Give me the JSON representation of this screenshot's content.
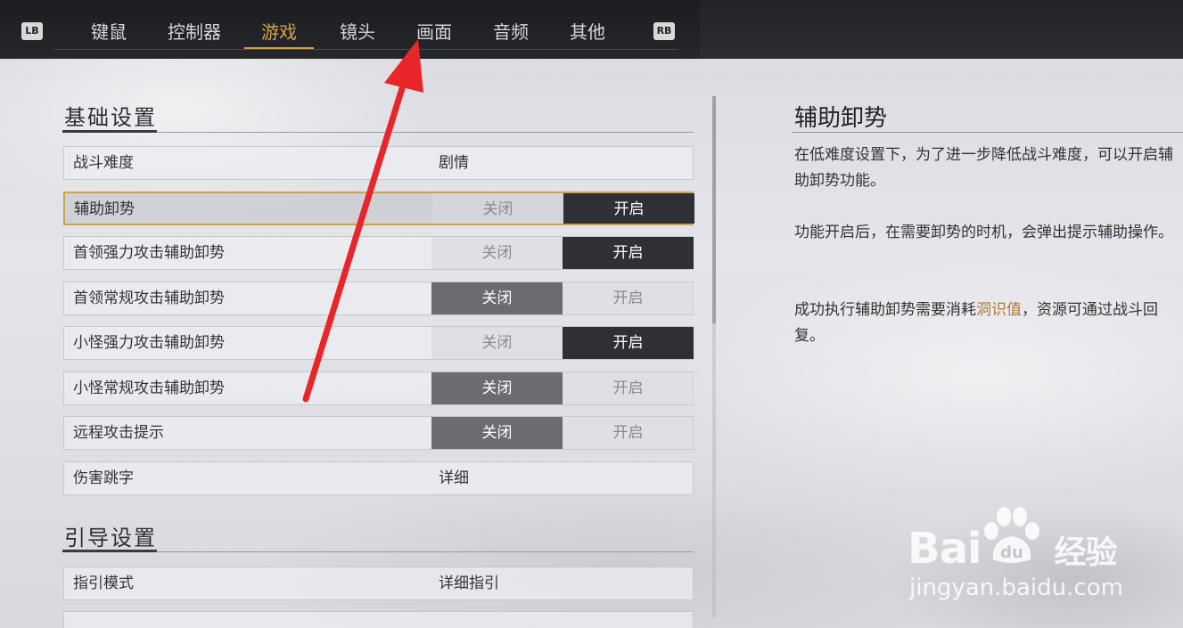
{
  "nav": {
    "left_shoulder": "LB",
    "right_shoulder": "RB",
    "tabs": [
      {
        "label": "键鼠",
        "active": false
      },
      {
        "label": "控制器",
        "active": false
      },
      {
        "label": "游戏",
        "active": true
      },
      {
        "label": "镜头",
        "active": false
      },
      {
        "label": "画面",
        "active": false
      },
      {
        "label": "音频",
        "active": false
      },
      {
        "label": "其他",
        "active": false
      }
    ],
    "active_color": "#d7a24a"
  },
  "sections": [
    {
      "title": "基础设置",
      "rows": [
        {
          "label": "战斗难度",
          "type": "value",
          "value": "剧情"
        },
        {
          "label": "辅助卸势",
          "type": "toggle",
          "off_label": "关闭",
          "on_label": "开启",
          "state": "on",
          "focused": true
        },
        {
          "label": "首领强力攻击辅助卸势",
          "type": "toggle",
          "off_label": "关闭",
          "on_label": "开启",
          "state": "on"
        },
        {
          "label": "首领常规攻击辅助卸势",
          "type": "toggle",
          "off_label": "关闭",
          "on_label": "开启",
          "state": "off"
        },
        {
          "label": "小怪强力攻击辅助卸势",
          "type": "toggle",
          "off_label": "关闭",
          "on_label": "开启",
          "state": "on"
        },
        {
          "label": "小怪常规攻击辅助卸势",
          "type": "toggle",
          "off_label": "关闭",
          "on_label": "开启",
          "state": "off"
        },
        {
          "label": "远程攻击提示",
          "type": "toggle",
          "off_label": "关闭",
          "on_label": "开启",
          "state": "off"
        },
        {
          "label": "伤害跳字",
          "type": "value",
          "value": "详细"
        }
      ]
    },
    {
      "title": "引导设置",
      "rows": [
        {
          "label": "指引模式",
          "type": "value",
          "value": "详细指引"
        }
      ]
    }
  ],
  "detail": {
    "title": "辅助卸势",
    "para1": "在低难度设置下，为了进一步降低战斗难度，可以开启辅助卸势功能。",
    "para2": "功能开启后，在需要卸势的时机，会弹出提示辅助操作。",
    "para3_before": "成功执行辅助卸势需要消耗",
    "para3_highlight": "洞识值",
    "para3_after": "，资源可通过战斗回复。",
    "highlight_color": "#b5752a"
  },
  "watermark": {
    "logo": "Bai",
    "logo_tail": "经验",
    "paw": "du",
    "url": "jingyan.baidu.com"
  },
  "annotation": {
    "color": "#e8262a"
  }
}
